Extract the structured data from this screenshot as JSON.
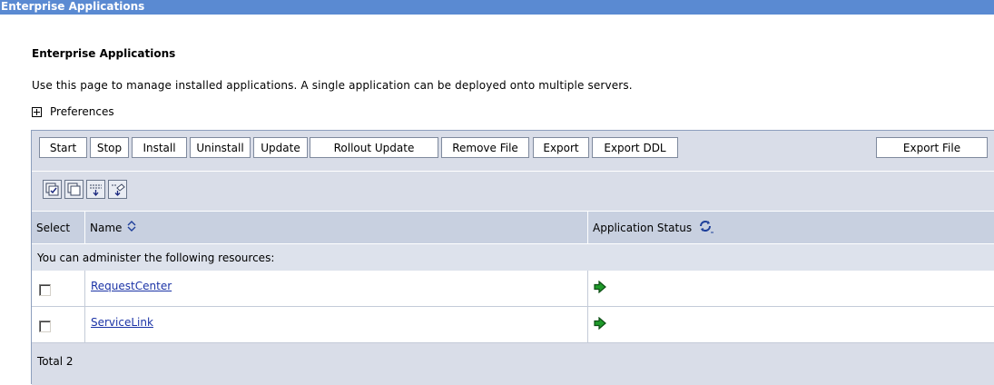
{
  "titlebar": "Enterprise Applications",
  "heading": "Enterprise Applications",
  "description": "Use this page to manage installed applications. A single application can be deployed onto multiple servers.",
  "preferences": "Preferences",
  "toolbar": {
    "start": "Start",
    "stop": "Stop",
    "install": "Install",
    "uninstall": "Uninstall",
    "update": "Update",
    "rollout_update": "Rollout Update",
    "remove_file": "Remove File",
    "export": "Export",
    "export_ddl": "Export DDL",
    "export_file": "Export File"
  },
  "icon_toolbar": [
    "select-all-icon",
    "deselect-all-icon",
    "show-filter-icon",
    "clear-filter-icon"
  ],
  "table": {
    "col_select": "Select",
    "col_name": "Name",
    "col_status": "Application Status",
    "admin_note": "You can administer the following resources:",
    "rows": [
      {
        "name": "RequestCenter",
        "checked": false,
        "status_icon": "started-arrow-icon"
      },
      {
        "name": "ServiceLink",
        "checked": false,
        "status_icon": "started-arrow-icon"
      }
    ],
    "total": "Total 2"
  },
  "colors": {
    "titlebar": "#5a8ad2",
    "toolbar_bg": "#d9dde8",
    "header_bg": "#c8d0e0",
    "link": "#1b33a6",
    "status_green": "#1f9a2a"
  }
}
